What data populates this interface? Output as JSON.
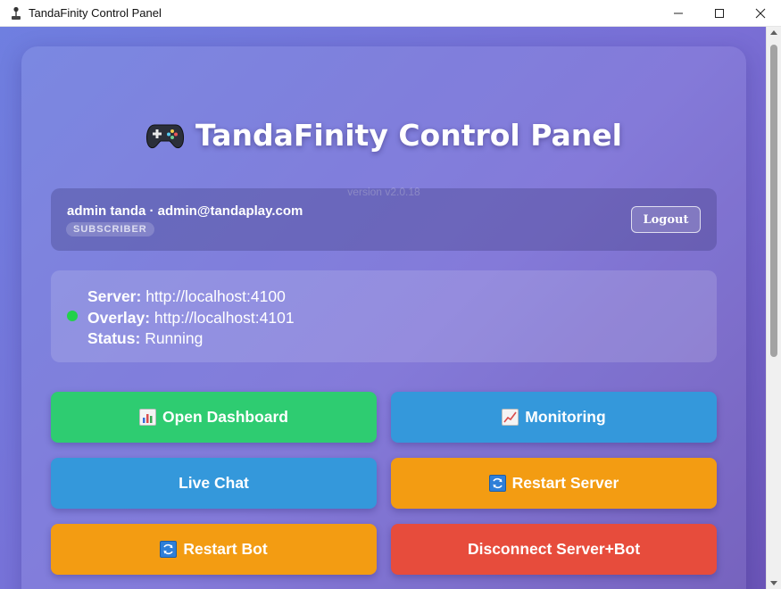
{
  "window": {
    "title": "TandaFinity Control Panel",
    "icon": "joystick-icon",
    "controls": {
      "minimize": "—",
      "maximize": "☐",
      "close": "✕"
    }
  },
  "header": {
    "title": "TandaFinity Control Panel",
    "icon": "gamepad-icon",
    "version": "version v2.0.18"
  },
  "user": {
    "line": "admin tanda · admin@tandaplay.com",
    "role": "SUBSCRIBER",
    "logout_label": "Logout"
  },
  "status": {
    "indicator_color": "#22d14a",
    "server_label": "Server:",
    "server_value": "http://localhost:4100",
    "overlay_label": "Overlay:",
    "overlay_value": "http://localhost:4101",
    "status_label": "Status:",
    "status_value": "Running"
  },
  "actions": {
    "open_dashboard": "Open Dashboard",
    "monitoring": "Monitoring",
    "live_chat": "Live Chat",
    "restart_server": "Restart Server",
    "restart_bot": "Restart Bot",
    "disconnect": "Disconnect Server+Bot"
  },
  "colors": {
    "green": "#2ecc71",
    "blue": "#3498db",
    "orange": "#f39c12",
    "red": "#e74c3c"
  }
}
